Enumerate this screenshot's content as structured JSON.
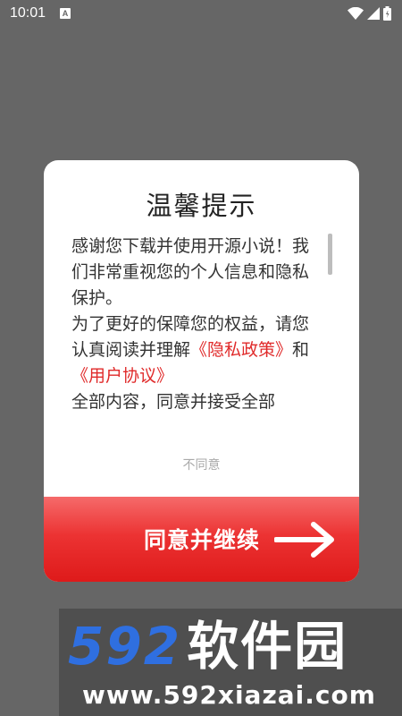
{
  "status_bar": {
    "time": "10:01",
    "notification_letter": "A",
    "icons": [
      "wifi-icon",
      "cellular-signal-icon",
      "battery-icon"
    ]
  },
  "dialog": {
    "title": "温馨提示",
    "body": {
      "text_1": "感谢您下载并使用开源小说！我们非常重视您的个人信息和隐私保护。",
      "text_2": "为了更好的保障您的权益，请您认真阅读并理解",
      "privacy_link": "《隐私政策》",
      "text_3": "和",
      "agreement_link": "《用户协议》",
      "text_4": "全部内容，同意并接受全部"
    },
    "disagree_label": "不同意",
    "agree_label": "同意并继续"
  },
  "watermark": {
    "logo_number": "592",
    "logo_text": "软件园",
    "url": "www.592xiazai.com"
  },
  "colors": {
    "overlay": "#666666",
    "link": "#e02a2a",
    "agree_button_top": "#f56a6a",
    "agree_button_bottom": "#de1a1a",
    "logo_blue": "#2f6fe0"
  }
}
